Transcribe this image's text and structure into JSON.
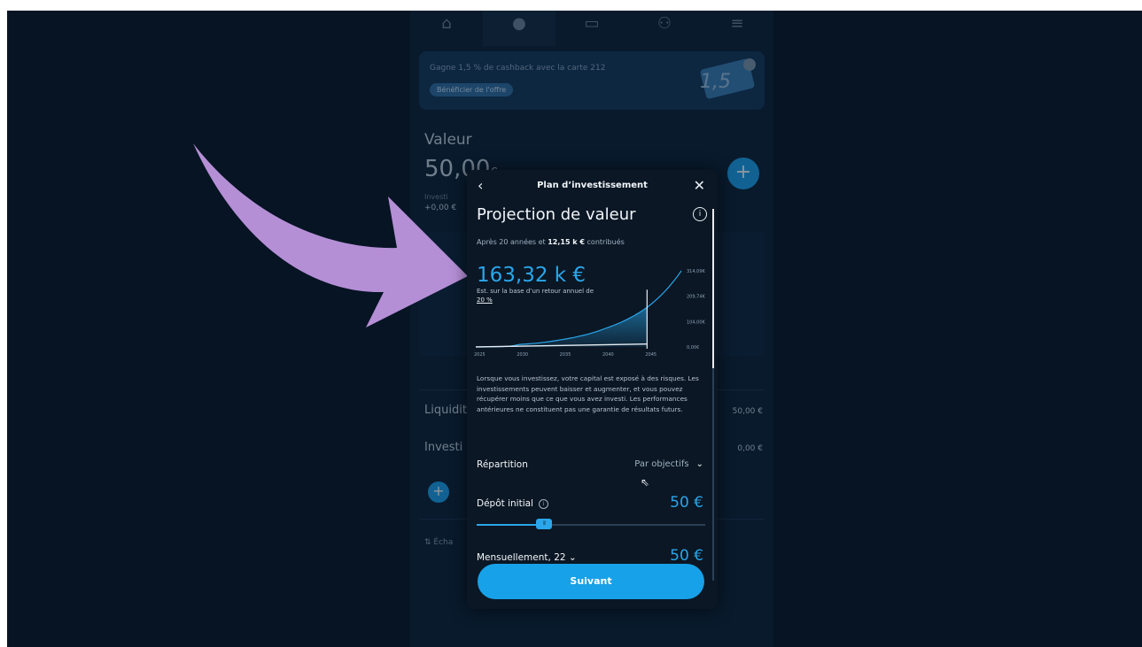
{
  "nav_icons": [
    "home-icon",
    "pie-chart-icon",
    "card-icon",
    "users-icon",
    "menu-icon"
  ],
  "background": {
    "promo_text": "Gagne 1,5 % de cashback avec la carte 212",
    "promo_button": "Bénéficier de l'offre",
    "promo_card_number": "1,5",
    "valeur_label": "Valeur",
    "amount": "50,00",
    "amount_currency": "€",
    "invested_label": "Investi",
    "gain": "+0,00 €",
    "liquidite_label": "Liquidit",
    "liquidite_value": "50,00 €",
    "investi_label": "Investi",
    "investi_value": "0,00 €",
    "echange_label": "Écha"
  },
  "modal": {
    "back_icon": "‹",
    "title": "Plan d’investissement",
    "close_icon": "✕",
    "heading": "Projection de valeur",
    "info_icon": "i",
    "subtitle_prefix": "Après 20 années et ",
    "subtitle_bold": "12,15 k €",
    "subtitle_suffix": " contribués",
    "projected_value": "163,32 k €",
    "estimate_text": "Est. sur la base d’un retour annuel de ",
    "estimate_rate": "20 %",
    "disclaimer": "Lorsque vous investissez, votre capital est exposé à des risques. Les investissements peuvent baisser et augmenter, et vous pouvez récupérer moins que ce que vous avez investi. Les performances antérieures ne constituent pas une garantie de résultats futurs.",
    "repartition_label": "Répartition",
    "repartition_value": "Par objectifs",
    "depot_label": "Dépôt initial",
    "depot_value": "50 €",
    "depot_slider_fraction": 0.18,
    "mensuel_label": "Mensuellement, 22",
    "mensuel_value": "50 €",
    "next_button": "Suivant"
  },
  "chart_data": {
    "type": "area",
    "x_ticks": [
      "2025",
      "2030",
      "2035",
      "2040",
      "2045"
    ],
    "y_ticks": [
      "0,00€",
      "104,00K",
      "209,74K",
      "314,09K"
    ],
    "series": [
      {
        "x": [
          2025,
          2030,
          2035,
          2040,
          2045,
          2049
        ],
        "values": [
          0.05,
          10,
          30,
          75,
          163.32,
          314.09
        ]
      },
      {
        "x": [
          2025,
          2045
        ],
        "values": [
          0.05,
          12.15
        ]
      }
    ],
    "marker_year": 2045,
    "ylim": [
      0,
      314.09
    ],
    "colors": {
      "projection": "#2aa6ea",
      "contributions": "#e8eef4"
    }
  }
}
